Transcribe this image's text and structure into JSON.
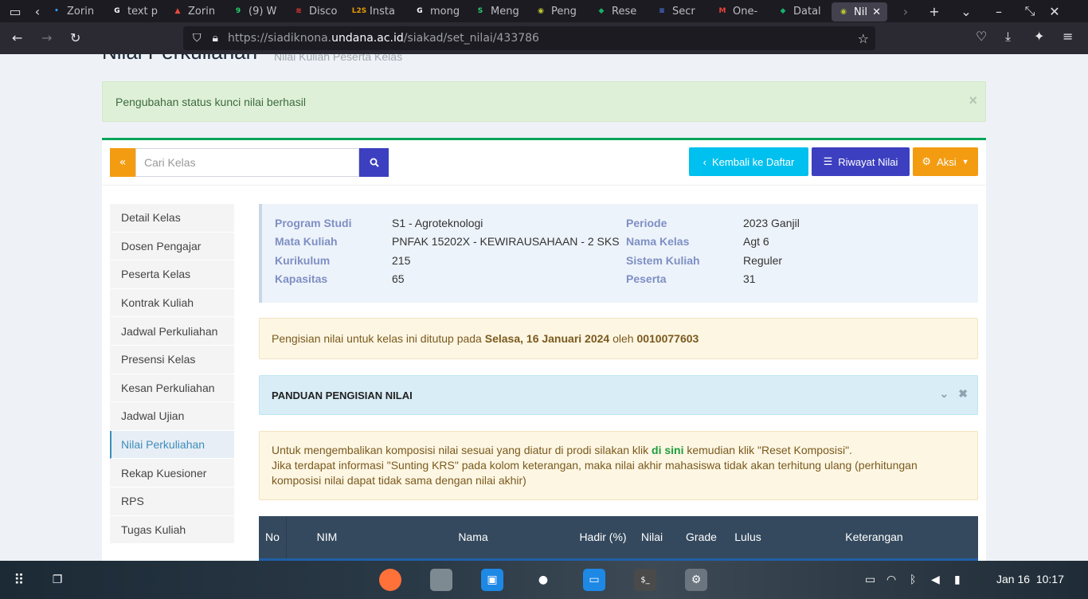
{
  "browser": {
    "tabs": [
      {
        "label": "Zorin",
        "color": "#2aa3ff",
        "glyph": "•"
      },
      {
        "label": "text p",
        "color": "#ffffff",
        "glyph": "G"
      },
      {
        "label": "Zorin",
        "color": "#e74c3c",
        "glyph": "▲"
      },
      {
        "label": "(9) W",
        "color": "#25d366",
        "glyph": "9"
      },
      {
        "label": "Disco",
        "color": "#ff3b30",
        "glyph": "≋"
      },
      {
        "label": "Insta",
        "color": "#e79a00",
        "glyph": "L2S"
      },
      {
        "label": "mong",
        "color": "#ffffff",
        "glyph": "G"
      },
      {
        "label": "Meng",
        "color": "#2ecc71",
        "glyph": "S"
      },
      {
        "label": "Peng",
        "color": "#c0ca33",
        "glyph": "◉"
      },
      {
        "label": "Rese",
        "color": "#17b26a",
        "glyph": "◆"
      },
      {
        "label": "Secr",
        "color": "#4c7df0",
        "glyph": "≡"
      },
      {
        "label": "One-",
        "color": "#ea4335",
        "glyph": "M"
      },
      {
        "label": "Datal",
        "color": "#17b26a",
        "glyph": "◆"
      },
      {
        "label": "Nil",
        "color": "#c0ca33",
        "glyph": "◉",
        "active": true
      }
    ],
    "url_prefix": "https://siadiknona.",
    "url_host": "undana.ac.id",
    "url_path": "/siakad/set_nilai/433786"
  },
  "page": {
    "title": "Nilai Perkuliahan",
    "subtitle": "Nilai Kuliah Peserta Kelas",
    "success_alert": "Pengubahan status kunci nilai berhasil",
    "close_glyph": "×"
  },
  "toolbar": {
    "collapse_label": "«",
    "search_placeholder": "Cari Kelas",
    "back_label": "Kembali ke Daftar",
    "history_label": "Riwayat Nilai",
    "action_label": "Aksi"
  },
  "sidebar": {
    "items": [
      {
        "label": "Detail Kelas"
      },
      {
        "label": "Dosen Pengajar"
      },
      {
        "label": "Peserta Kelas"
      },
      {
        "label": "Kontrak Kuliah"
      },
      {
        "label": "Jadwal Perkuliahan"
      },
      {
        "label": "Presensi Kelas"
      },
      {
        "label": "Kesan Perkuliahan"
      },
      {
        "label": "Jadwal Ujian"
      },
      {
        "label": "Nilai Perkuliahan",
        "active": true
      },
      {
        "label": "Rekap Kuesioner"
      },
      {
        "label": "RPS"
      },
      {
        "label": "Tugas Kuliah"
      }
    ]
  },
  "class_info": {
    "program_studi_label": "Program Studi",
    "program_studi": "S1 - Agroteknologi",
    "mata_kuliah_label": "Mata Kuliah",
    "mata_kuliah": "PNFAK 15202X - KEWIRAUSAHAAN - 2 SKS",
    "kurikulum_label": "Kurikulum",
    "kurikulum": "215",
    "kapasitas_label": "Kapasitas",
    "kapasitas": "65",
    "periode_label": "Periode",
    "periode": "2023 Ganjil",
    "nama_kelas_label": "Nama Kelas",
    "nama_kelas": "Agt 6",
    "sistem_kuliah_label": "Sistem Kuliah",
    "sistem_kuliah": "Reguler",
    "peserta_label": "Peserta",
    "peserta": "31"
  },
  "lock_notice": {
    "prefix": "Pengisian nilai untuk kelas ini ditutup pada ",
    "date": "Selasa, 16 Januari 2024",
    "middle": " oleh ",
    "user": "0010077603"
  },
  "guide": {
    "title": "PANDUAN PENGISIAN NILAI"
  },
  "reset_notice": {
    "line1_prefix": "Untuk mengembalikan komposisi nilai sesuai yang diatur di prodi silakan klik ",
    "link": "di sini",
    "line1_suffix": " kemudian klik \"Reset Komposisi\".",
    "line2": "Jika terdapat informasi \"Sunting KRS\" pada kolom keterangan, maka nilai akhir mahasiswa tidak akan terhitung ulang (perhitungan komposisi nilai dapat tidak sama dengan nilai akhir)"
  },
  "table": {
    "headers": [
      "No",
      "NIM",
      "Nama",
      "Hadir (%)",
      "Nilai",
      "Grade",
      "Lulus",
      "Keterangan"
    ]
  },
  "taskbar": {
    "date": "Jan 16",
    "time": "10:17"
  }
}
